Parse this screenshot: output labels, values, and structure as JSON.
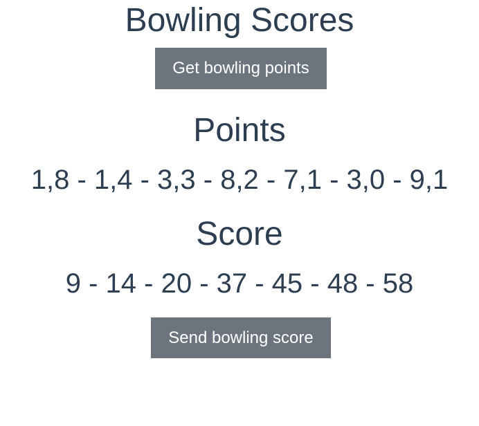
{
  "app": {
    "title": "Bowling Scores"
  },
  "buttons": {
    "get_points_label": "Get bowling points",
    "send_score_label": "Send bowling score"
  },
  "points": {
    "heading": "Points",
    "values": "1,8 - 1,4 - 3,3 - 8,2 - 7,1 - 3,0 - 9,1"
  },
  "score": {
    "heading": "Score",
    "values": "9 - 14 - 20 - 37 - 45 - 48 - 58"
  },
  "colors": {
    "text": "#2c3e50",
    "button_bg": "#6c757d",
    "button_text": "#ffffff",
    "background": "#ffffff"
  }
}
